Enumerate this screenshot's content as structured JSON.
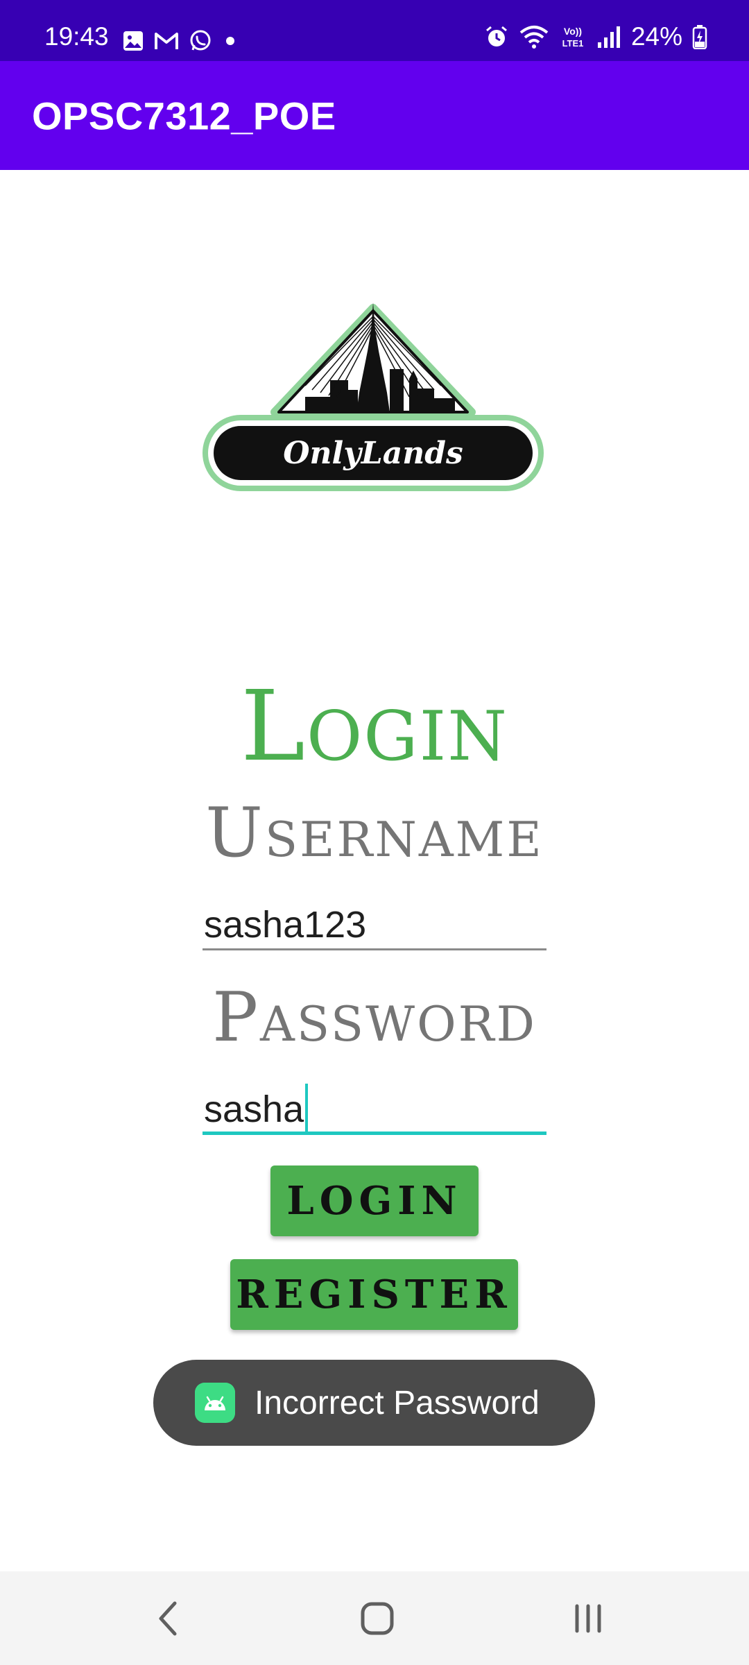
{
  "status_bar": {
    "time": "19:43",
    "battery": "24%",
    "left_icons": [
      "gallery-icon",
      "gmail-icon",
      "whatsapp-icon",
      "dot-icon"
    ],
    "right_icons": [
      "alarm-icon",
      "wifi-icon",
      "volte-icon",
      "signal-icon",
      "battery-charging-icon"
    ]
  },
  "app_bar": {
    "title": "OPSC7312_POE"
  },
  "logo": {
    "text": "OnlyLands"
  },
  "form": {
    "heading": "Login",
    "username_label": "Username",
    "username_value": "sasha123",
    "password_label": "Password",
    "password_value": "sasha"
  },
  "buttons": {
    "login": "LOGIN",
    "register": "REGISTER"
  },
  "toast": {
    "message": "Incorrect Password",
    "icon": "android-icon"
  },
  "nav_bar": {
    "icons": [
      "back-icon",
      "home-icon",
      "recents-icon"
    ]
  },
  "colors": {
    "status_bar": "#3700b3",
    "app_bar": "#6200ee",
    "accent_green": "#4caf50",
    "field_focus": "#1ec8c0",
    "toast_bg": "#4a4a4a"
  }
}
